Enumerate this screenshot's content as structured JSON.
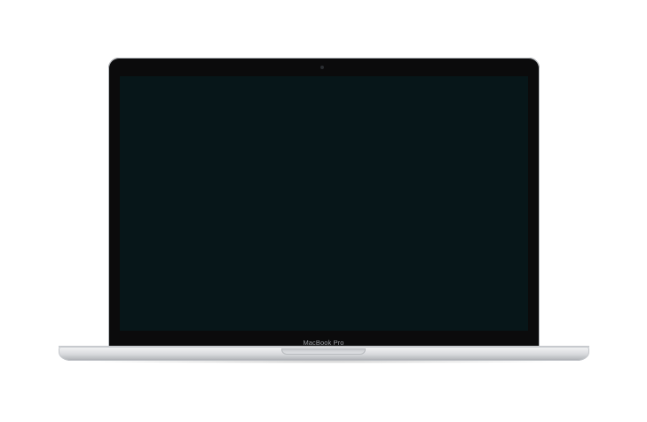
{
  "device": {
    "brand_label": "MacBook Pro",
    "screen_color": "#071619",
    "bezel_color": "#0b0b0c",
    "body_color": "#d7d9dc"
  }
}
